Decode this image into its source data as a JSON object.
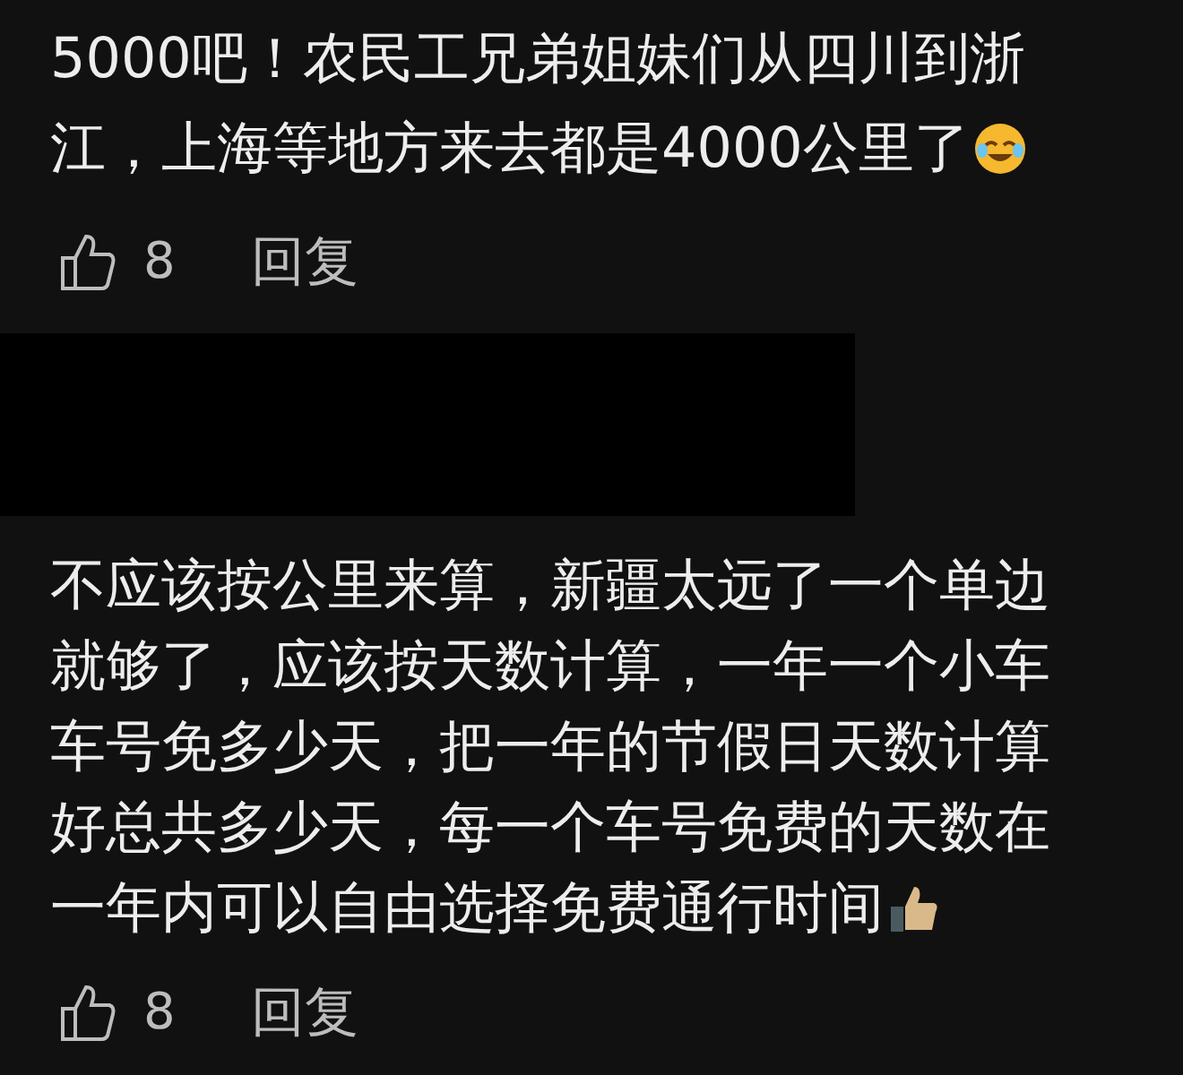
{
  "comments": [
    {
      "redacted_header": false,
      "lines": [
        "5000吧！农民工兄弟姐妹们从四川到浙",
        "江，上海等地方来去都是4000公里了"
      ],
      "emoji": {
        "kind": "laugh"
      },
      "likes": "8",
      "reply": "回复"
    },
    {
      "redacted_header": true,
      "lines": [
        "不应该按公里来算，新疆太远了一个单边",
        "就够了，应该按天数计算，一年一个小车",
        "车号免多少天，把一年的节假日天数计算",
        "好总共多少天，每一个车号免费的天数在",
        "一年内可以自由选择免费通行时间"
      ],
      "emoji": {
        "kind": "thumbs"
      },
      "likes": "8",
      "reply": "回复"
    }
  ]
}
